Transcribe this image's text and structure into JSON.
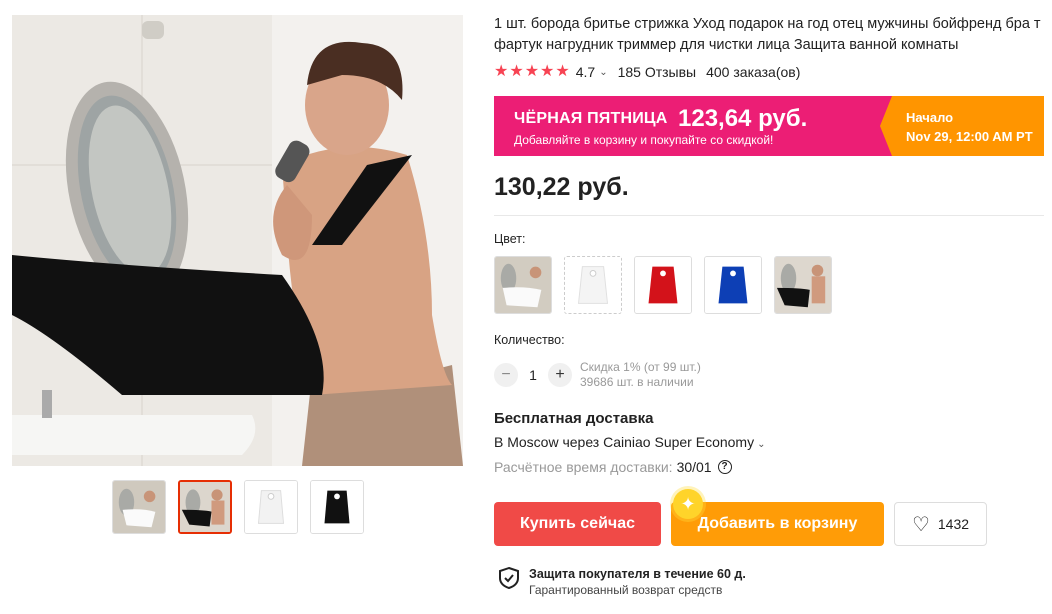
{
  "product": {
    "title": "1 шт. борода бритье стрижка Уход подарок на год отец мужчины бойфренд бра т фартук нагрудник триммер для чистки лица Защита ванной комнаты",
    "rating": "4.7",
    "reviews": "185 Отзывы",
    "orders": "400 заказа(ов)",
    "price": "130,22 руб."
  },
  "promo": {
    "event": "ЧЁРНАЯ ПЯТНИЦА",
    "price": "123,64 руб.",
    "subtitle": "Добавляйте в корзину и покупайте со скидкой!",
    "start_label": "Начало",
    "start_date": "Nov 29, 12:00 AM PT"
  },
  "options": {
    "color_label": "Цвет:",
    "colors": [
      "photo-white-apron",
      "white",
      "red",
      "blue",
      "photo-black-apron"
    ]
  },
  "quantity": {
    "label": "Количество:",
    "value": "1",
    "discount": "Скидка 1% (от 99 шт.)",
    "stock": "39686 шт. в наличии"
  },
  "shipping": {
    "title": "Бесплатная доставка",
    "method": "В Moscow через Cainiao Super Economy",
    "time_label": "Расчётное время доставки:",
    "time_value": "30/01"
  },
  "actions": {
    "buy": "Купить сейчас",
    "add_to_cart": "Добавить в корзину",
    "wishlist_count": "1432"
  },
  "protection": {
    "title": "Защита покупателя в течение 60 д.",
    "subtitle": "Гарантированный возврат средств"
  },
  "gallery": {
    "thumbs": [
      "photo-white-apron",
      "photo-black-apron",
      "white-apron",
      "black-apron"
    ],
    "selected_index": 1
  },
  "colors": {
    "accent_red": "#f04a47",
    "promo_pink": "#ec1e75",
    "promo_orange": "#ff9500",
    "cart_orange": "#ff9c07",
    "star": "#f74353"
  },
  "icons": [
    "star-icon",
    "chevron-down-icon",
    "minus-icon",
    "plus-icon",
    "help-icon",
    "heart-icon",
    "shield-check-icon",
    "sparkle-icon"
  ]
}
